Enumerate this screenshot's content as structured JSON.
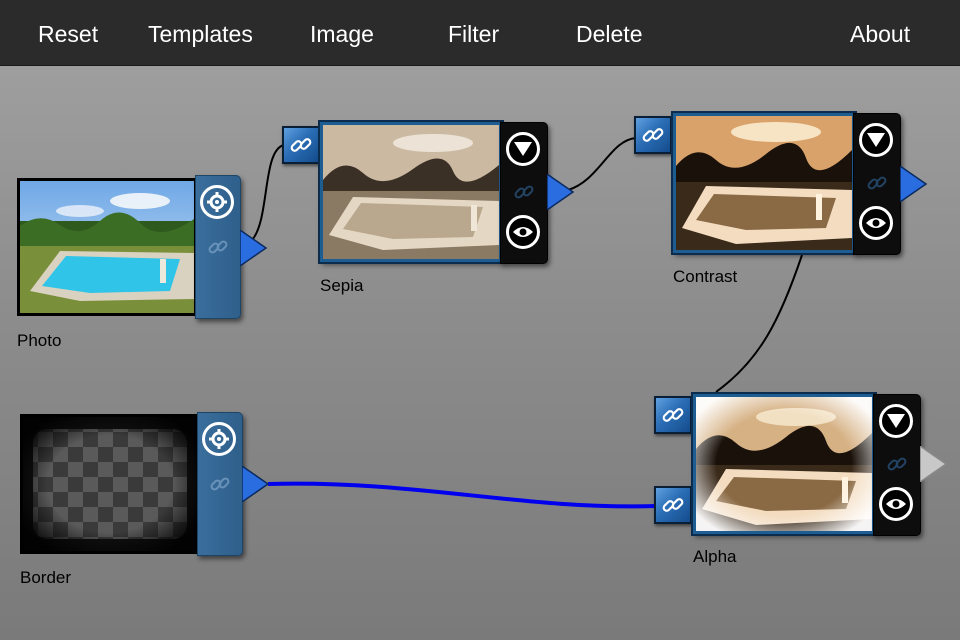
{
  "toolbar": {
    "reset": "Reset",
    "templates": "Templates",
    "image": "Image",
    "filter": "Filter",
    "delete": "Delete",
    "about": "About"
  },
  "nodes": {
    "photo": {
      "label": "Photo"
    },
    "sepia": {
      "label": "Sepia"
    },
    "contrast": {
      "label": "Contrast"
    },
    "border": {
      "label": "Border"
    },
    "alpha": {
      "label": "Alpha"
    }
  },
  "colors": {
    "toolbar_bg": "#2b2b2b",
    "panel_blue": "#2f5f8b",
    "link_blue": "#2a6db5",
    "wire_active": "#0000ee"
  },
  "icons": {
    "settings": "gear-icon",
    "link": "link-icon",
    "preview": "eye-icon",
    "expand": "triangle-down-icon",
    "output": "triangle-right-icon"
  }
}
